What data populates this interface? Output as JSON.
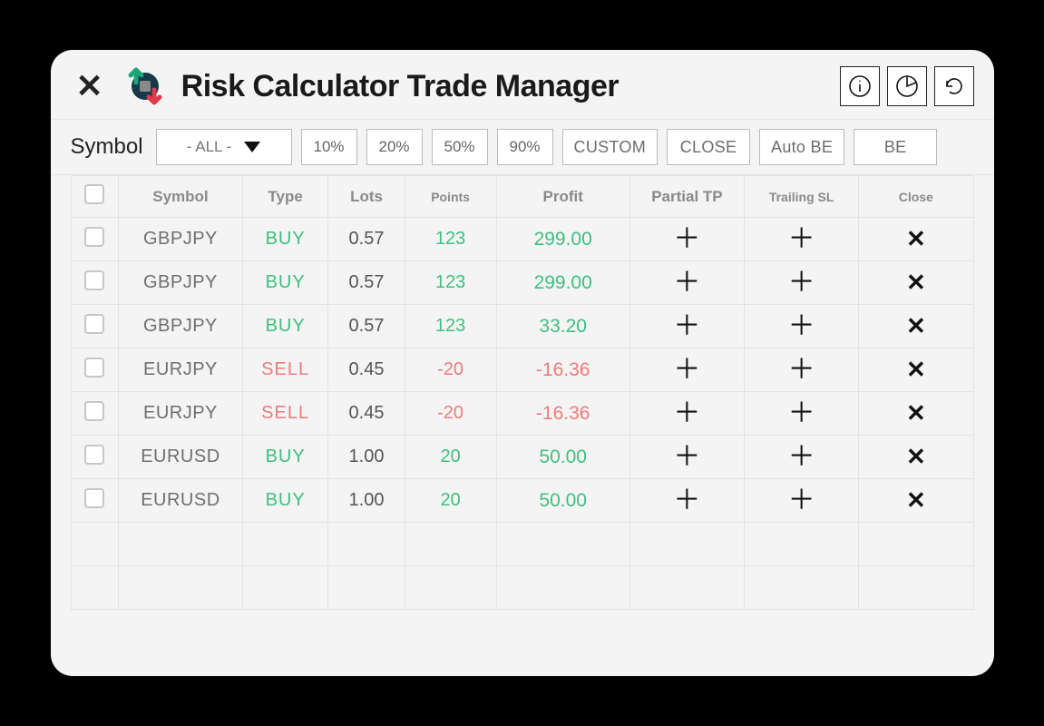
{
  "title": "Risk Calculator Trade Manager",
  "icons": {
    "close": "close-icon",
    "info": "info-icon",
    "pie": "pie-chart-icon",
    "refresh": "refresh-icon",
    "logo": "trade-logo"
  },
  "toolbar": {
    "symbol_label": "Symbol",
    "symbol_filter": "- ALL -",
    "percent_buttons": [
      "10%",
      "20%",
      "50%",
      "90%"
    ],
    "extra_buttons": [
      "CUSTOM",
      "CLOSE",
      "Auto BE",
      "BE"
    ]
  },
  "columns": [
    "",
    "Symbol",
    "Type",
    "Lots",
    "Points",
    "Profit",
    "Partial TP",
    "Trailing  SL",
    "Close"
  ],
  "rows": [
    {
      "symbol": "GBPJPY",
      "type": "BUY",
      "lots": "0.57",
      "points": "123",
      "profit": "299.00",
      "dir": "pos"
    },
    {
      "symbol": "GBPJPY",
      "type": "BUY",
      "lots": "0.57",
      "points": "123",
      "profit": "299.00",
      "dir": "pos"
    },
    {
      "symbol": "GBPJPY",
      "type": "BUY",
      "lots": "0.57",
      "points": "123",
      "profit": "33.20",
      "dir": "pos"
    },
    {
      "symbol": "EURJPY",
      "type": "SELL",
      "lots": "0.45",
      "points": "-20",
      "profit": "-16.36",
      "dir": "neg"
    },
    {
      "symbol": "EURJPY",
      "type": "SELL",
      "lots": "0.45",
      "points": "-20",
      "profit": "-16.36",
      "dir": "neg"
    },
    {
      "symbol": "EURUSD",
      "type": "BUY",
      "lots": "1.00",
      "points": "20",
      "profit": "50.00",
      "dir": "pos"
    },
    {
      "symbol": "EURUSD",
      "type": "BUY",
      "lots": "1.00",
      "points": "20",
      "profit": "50.00",
      "dir": "pos"
    }
  ],
  "empty_rows": 2,
  "glyphs": {
    "plus": "＋",
    "cross": "✕"
  }
}
